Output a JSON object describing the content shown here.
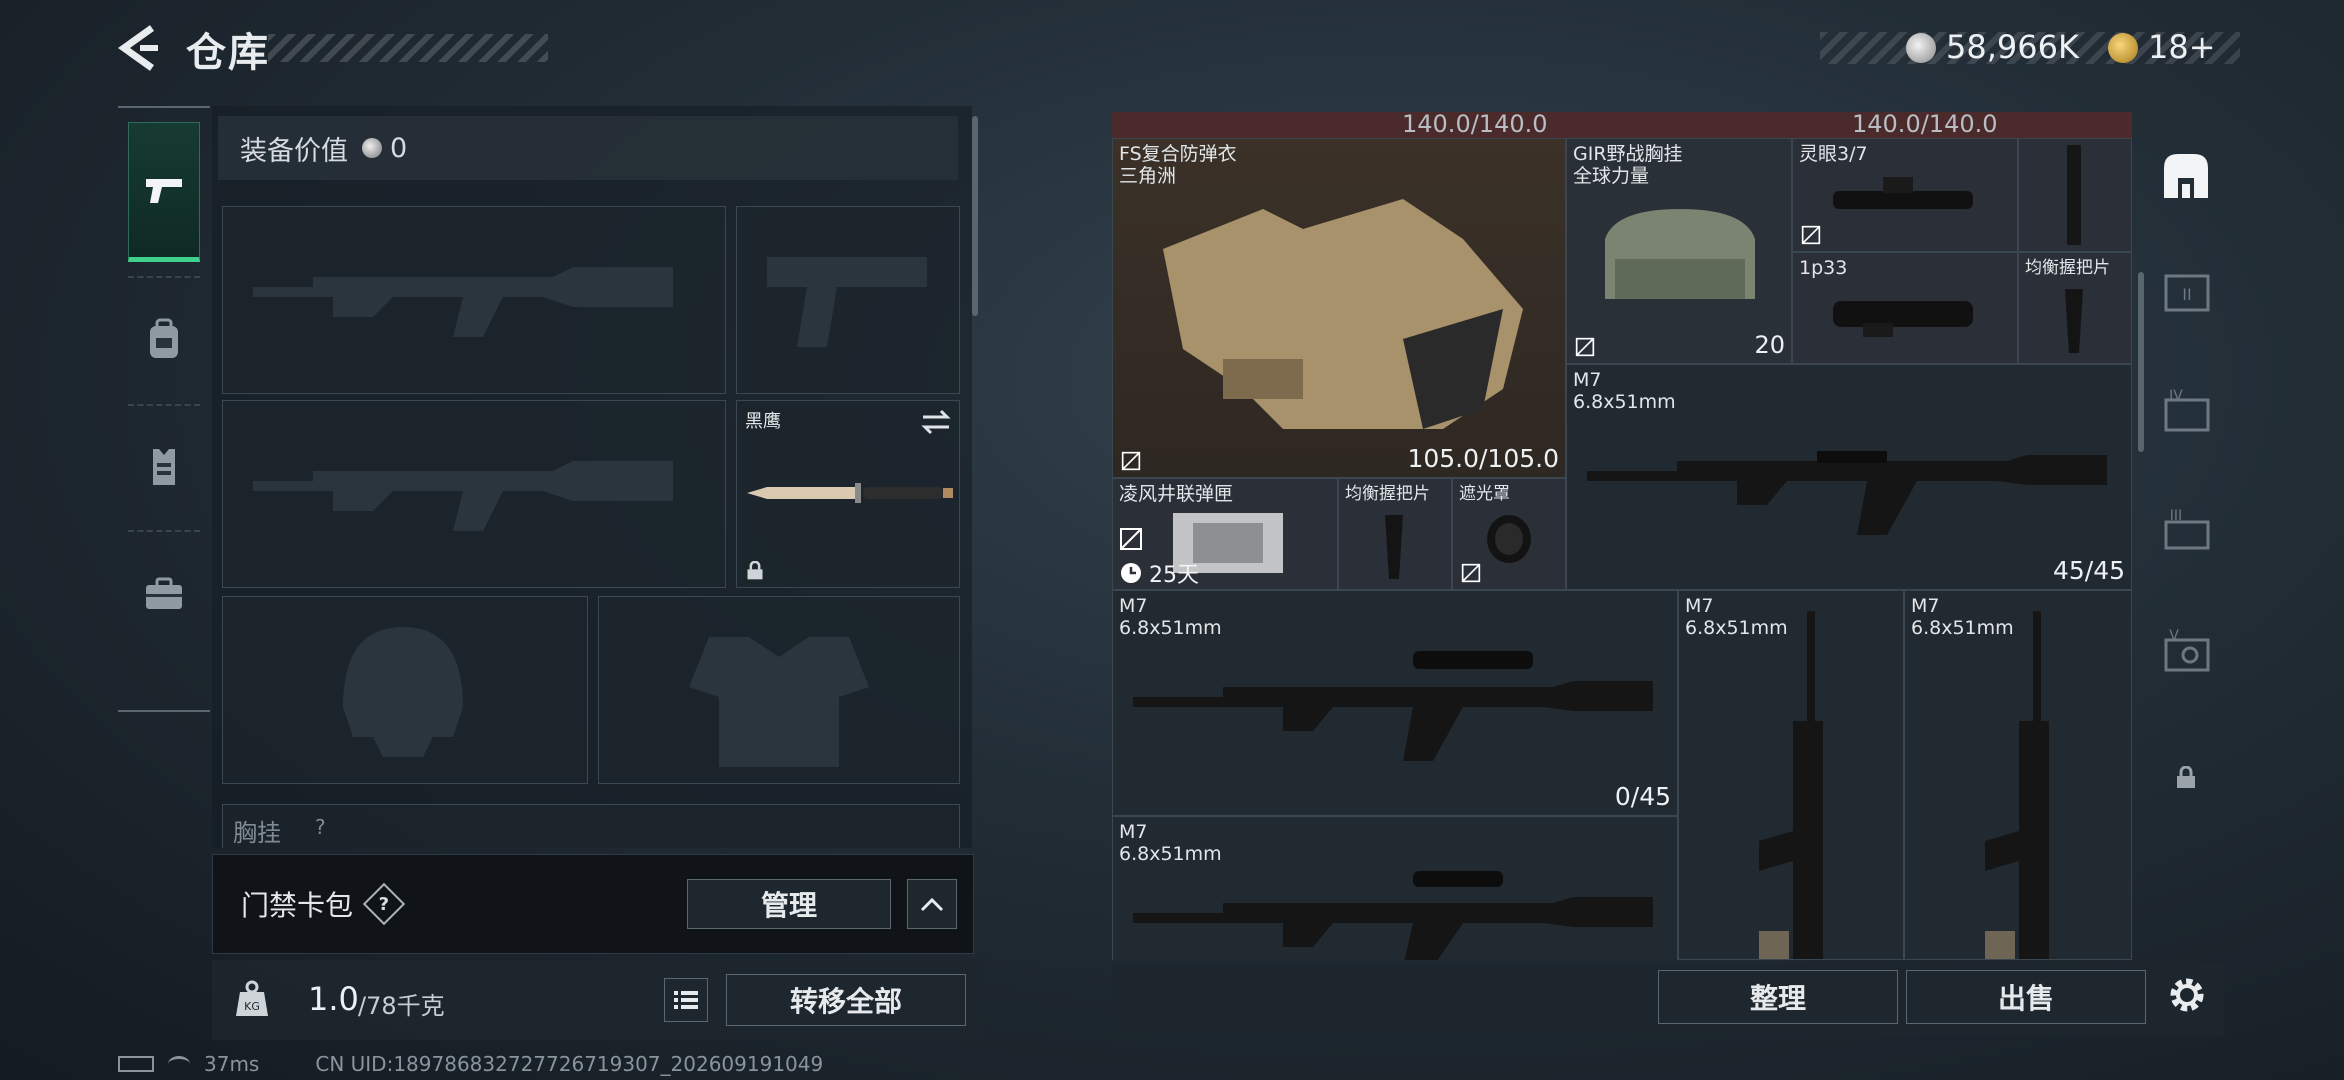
{
  "header": {
    "title": "仓库",
    "currency1": "58,966K",
    "currency2": "18+"
  },
  "sidebar": {
    "tabs": [
      {
        "icon": "pistol-icon",
        "active": true
      },
      {
        "icon": "backpack-icon",
        "active": false
      },
      {
        "icon": "vest-icon",
        "active": false
      },
      {
        "icon": "briefcase-icon",
        "active": false
      }
    ]
  },
  "equipment": {
    "value_label": "装备价值",
    "value": "0",
    "knife_label": "黑鹰",
    "partial_label": "胸挂",
    "partial_q": "?"
  },
  "cardbag": {
    "label": "门禁卡包",
    "help": "?",
    "manage": "管理"
  },
  "weight": {
    "current": "1.0",
    "max": "/78千克",
    "transfer_all": "转移全部"
  },
  "stash": {
    "top_strip_left": "140.0/140.0",
    "top_strip_right": "140.0/140.0",
    "items": {
      "armor": {
        "name": "FS复合防弹衣",
        "sub": "三角洲",
        "durability": "105.0/105.0"
      },
      "rig": {
        "name": "GIR野战胸挂",
        "sub": "全球力量",
        "count": "20"
      },
      "scope1": {
        "name": "灵眼3/7"
      },
      "scope2": {
        "name": "1p33"
      },
      "grip1": {
        "name": "均衡握把片"
      },
      "vest2": {
        "name": "凌风井联弹匣",
        "timer": "25天"
      },
      "grip2": {
        "name": "均衡握把片"
      },
      "shade": {
        "name": "遮光罩"
      },
      "m7a": {
        "name": "M7",
        "caliber": "6.8x51mm",
        "ammo": "45/45"
      },
      "m7b": {
        "name": "M7",
        "caliber": "6.8x51mm",
        "ammo": "0/45"
      },
      "m7c": {
        "name": "M7",
        "caliber": "6.8x51mm"
      },
      "m7d": {
        "name": "M7",
        "caliber": "6.8x51mm"
      },
      "m7e": {
        "name": "M7",
        "caliber": "6.8x51mm"
      }
    }
  },
  "right_tabs": {
    "labels": [
      "",
      "II",
      "IV",
      "III",
      "V"
    ]
  },
  "actions": {
    "sort": "整理",
    "sell": "出售"
  },
  "status": {
    "ping": "37ms",
    "uid": "CN UID:18978683272772671930​7_202609191049"
  }
}
